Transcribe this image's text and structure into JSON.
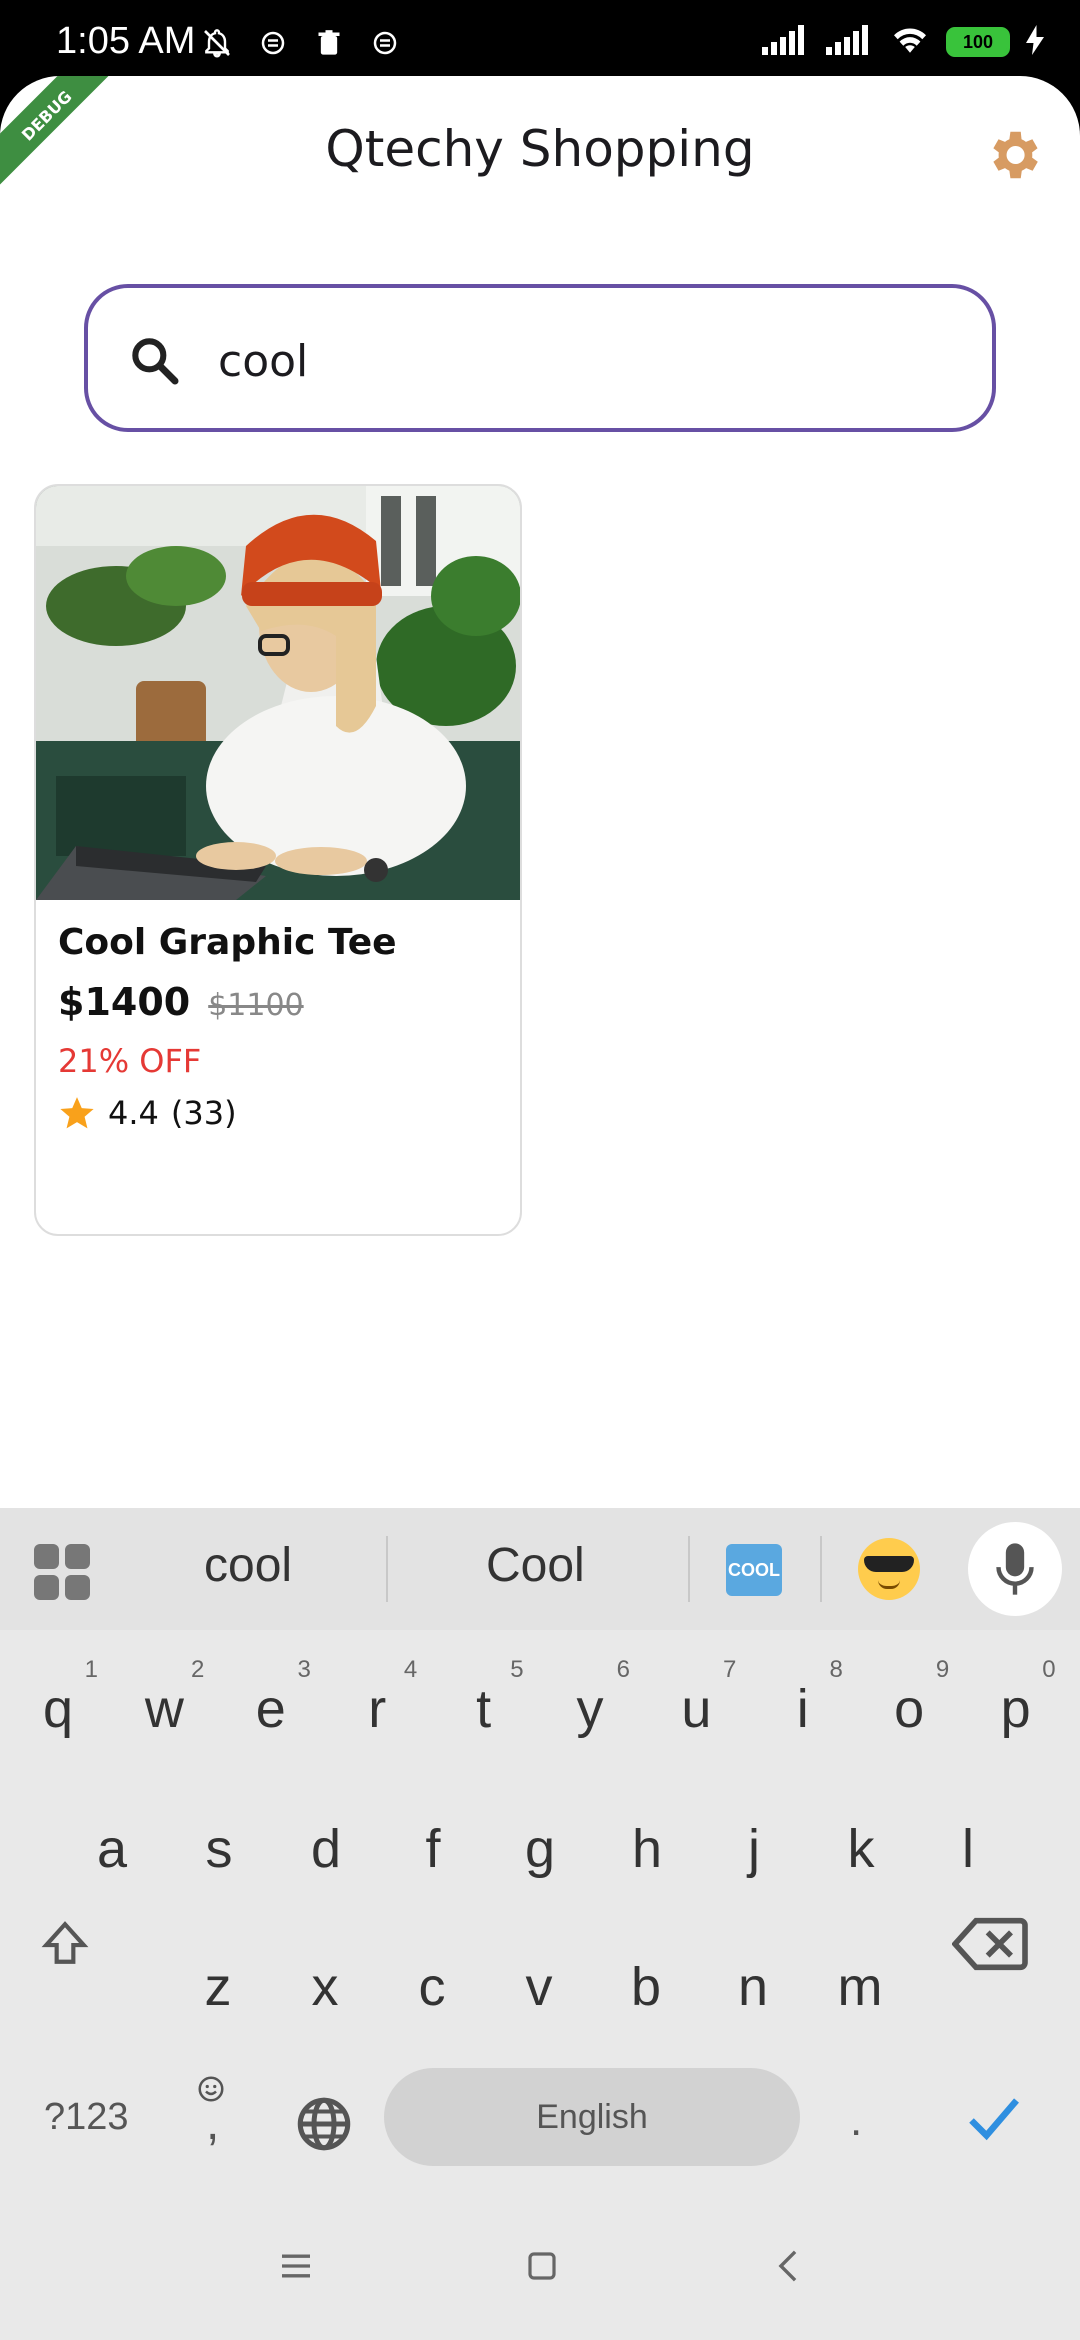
{
  "status_bar": {
    "time": "1:05 AM",
    "battery": "100"
  },
  "app": {
    "title": "Qtechy Shopping",
    "debug_banner": "DEBUG",
    "accent_color": "#6750a4",
    "settings_icon_color": "#d79b62"
  },
  "search": {
    "value": "cool",
    "icon": "search-icon"
  },
  "products": [
    {
      "name": "Cool Graphic Tee",
      "price": "$1400",
      "old_price": "$1100",
      "discount": "21% OFF",
      "rating": "4.4",
      "rating_count": "(33)"
    }
  ],
  "keyboard": {
    "suggestions": [
      "cool",
      "Cool"
    ],
    "emoji_cool_label": "COOL",
    "row1": [
      "q",
      "w",
      "e",
      "r",
      "t",
      "y",
      "u",
      "i",
      "o",
      "p"
    ],
    "row1_hints": [
      "1",
      "2",
      "3",
      "4",
      "5",
      "6",
      "7",
      "8",
      "9",
      "0"
    ],
    "row2": [
      "a",
      "s",
      "d",
      "f",
      "g",
      "h",
      "j",
      "k",
      "l"
    ],
    "row3": [
      "z",
      "x",
      "c",
      "v",
      "b",
      "n",
      "m"
    ],
    "symbols_key": "?123",
    "comma_key": ",",
    "space_label": "English",
    "period_key": "."
  }
}
